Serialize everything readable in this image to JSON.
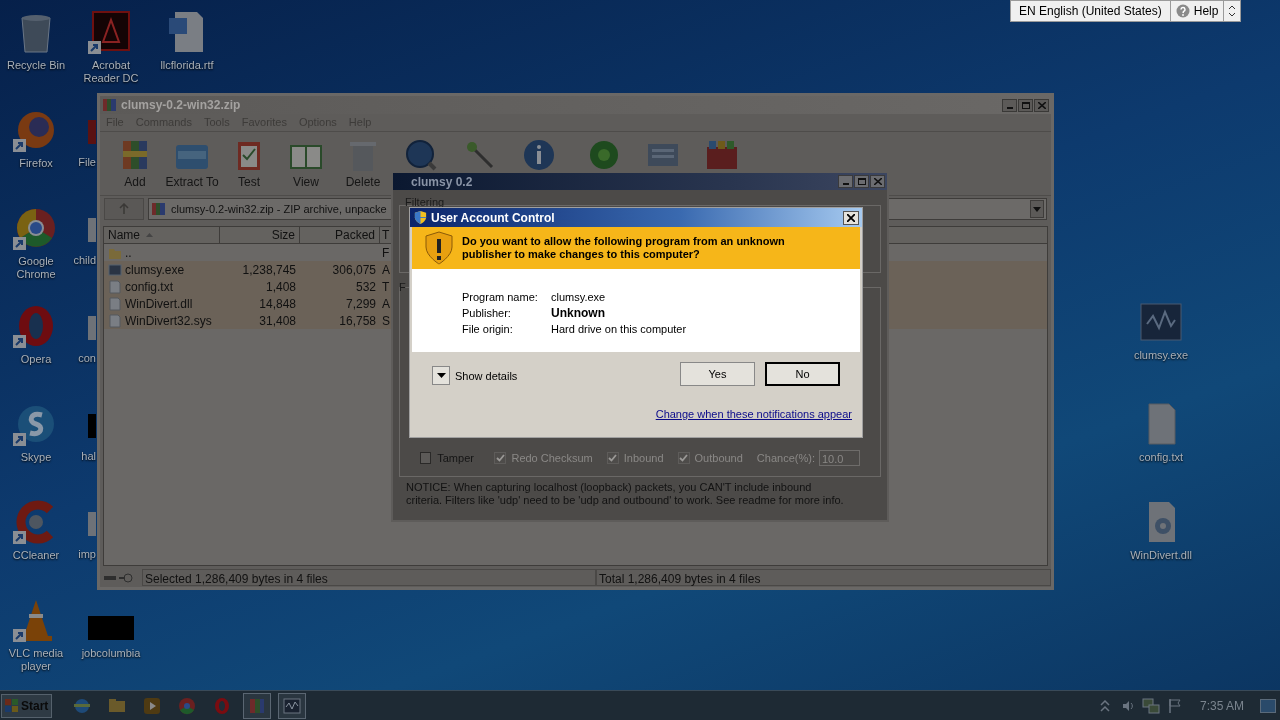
{
  "language_bar": {
    "language": "EN English (United States)",
    "help": "Help"
  },
  "desktop_icons": [
    {
      "label": "Recycle Bin",
      "kind": "recycle",
      "shortcut": false
    },
    {
      "label": "Acrobat Reader DC",
      "kind": "acrobat",
      "shortcut": true
    },
    {
      "label": "llcflorida.rtf",
      "kind": "word",
      "shortcut": false
    },
    {
      "label": "Firefox",
      "kind": "firefox",
      "shortcut": true
    },
    {
      "label": "Google Chrome",
      "kind": "chrome",
      "shortcut": true
    },
    {
      "label": "Opera",
      "kind": "opera",
      "shortcut": true
    },
    {
      "label": "Skype",
      "kind": "skype",
      "shortcut": true
    },
    {
      "label": "CCleaner",
      "kind": "ccleaner",
      "shortcut": true
    },
    {
      "label": "VLC media player",
      "kind": "vlc",
      "shortcut": true
    },
    {
      "label": "jobcolumbia",
      "kind": "black",
      "shortcut": false
    },
    {
      "label": "clumsy.exe",
      "kind": "exe",
      "shortcut": false
    },
    {
      "label": "config.txt",
      "kind": "text",
      "shortcut": false
    },
    {
      "label": "WinDivert.dll",
      "kind": "dll",
      "shortcut": false
    }
  ],
  "cut_icons": [
    {
      "label": "File",
      "kind": "red"
    },
    {
      "label": "child",
      "kind": "doc"
    },
    {
      "label": "con",
      "kind": "doc"
    },
    {
      "label": "hal",
      "kind": "black"
    },
    {
      "label": "imp",
      "kind": "doc"
    }
  ],
  "archiver": {
    "title": "clumsy-0.2-win32.zip",
    "menu": [
      "File",
      "Commands",
      "Tools",
      "Favorites",
      "Options",
      "Help"
    ],
    "toolbar": [
      {
        "label": "Add",
        "kind": "add"
      },
      {
        "label": "Extract To",
        "kind": "extract"
      },
      {
        "label": "Test",
        "kind": "test"
      },
      {
        "label": "View",
        "kind": "view"
      },
      {
        "label": "Delete",
        "kind": "delete"
      },
      {
        "kind": "find"
      },
      {
        "kind": "wizard"
      },
      {
        "kind": "info"
      },
      {
        "kind": "virus"
      },
      {
        "kind": "comment"
      },
      {
        "kind": "sfx"
      }
    ],
    "address": "clumsy-0.2-win32.zip - ZIP archive, unpacke",
    "columns": [
      "Name",
      "Size",
      "Packed",
      "T"
    ],
    "rows": [
      {
        "name": "..",
        "kind": "folder",
        "column_4": "F",
        "selected": false
      },
      {
        "name": "clumsy.exe",
        "kind": "exe",
        "size": "1,238,745",
        "packed": "306,075",
        "column_4": "A",
        "selected": true
      },
      {
        "name": "config.txt",
        "kind": "text",
        "size": "1,408",
        "packed": "532",
        "column_4": "T",
        "selected": true
      },
      {
        "name": "WinDivert.dll",
        "kind": "dll",
        "size": "14,848",
        "packed": "7,299",
        "column_4": "A",
        "selected": true
      },
      {
        "name": "WinDivert32.sys",
        "kind": "dll",
        "size": "31,408",
        "packed": "16,758",
        "column_4": "S",
        "selected": true
      }
    ],
    "status_left": "Selected 1,286,409 bytes in 4 files",
    "status_right": "Total 1,286,409 bytes in 4 files"
  },
  "clumsy": {
    "title": "clumsy 0.2",
    "filtering_label": "Filtering",
    "functions_label": "F",
    "function_row": {
      "name": "Tamper",
      "enabled": false,
      "options": [
        {
          "label": "Redo Checksum",
          "checked": true
        },
        {
          "label": "Inbound",
          "checked": true
        },
        {
          "label": "Outbound",
          "checked": true
        }
      ],
      "chance_label": "Chance(%):",
      "chance": "10.0"
    },
    "notice": "NOTICE: When capturing localhost (loopback) packets, you CAN'T include inbound criteria. Filters like 'udp' need to be 'udp and outbound' to work. See readme for more info."
  },
  "uac": {
    "title": "User Account Control",
    "question": "Do you want to allow the following program from an unknown publisher to make changes to this computer?",
    "details": [
      {
        "label": "Program name:",
        "value": "clumsy.exe",
        "emphasis": false
      },
      {
        "label": "Publisher:",
        "value": "Unknown",
        "emphasis": true
      },
      {
        "label": "File origin:",
        "value": "Hard drive on this computer",
        "emphasis": false
      }
    ],
    "show_details": "Show details",
    "buttons": [
      {
        "label": "Yes",
        "default": false
      },
      {
        "label": "No",
        "default": true
      }
    ],
    "link": "Change when these notifications appear"
  },
  "taskbar": {
    "start": "Start",
    "apps": [
      {
        "kind": "ie",
        "active": false
      },
      {
        "kind": "explorer",
        "active": false
      },
      {
        "kind": "media",
        "active": false
      },
      {
        "kind": "chrome",
        "active": false
      },
      {
        "kind": "opera",
        "active": false
      },
      {
        "kind": "winrar",
        "active": true
      },
      {
        "kind": "clumsy",
        "active": true
      }
    ],
    "clock": "7:35 AM"
  }
}
